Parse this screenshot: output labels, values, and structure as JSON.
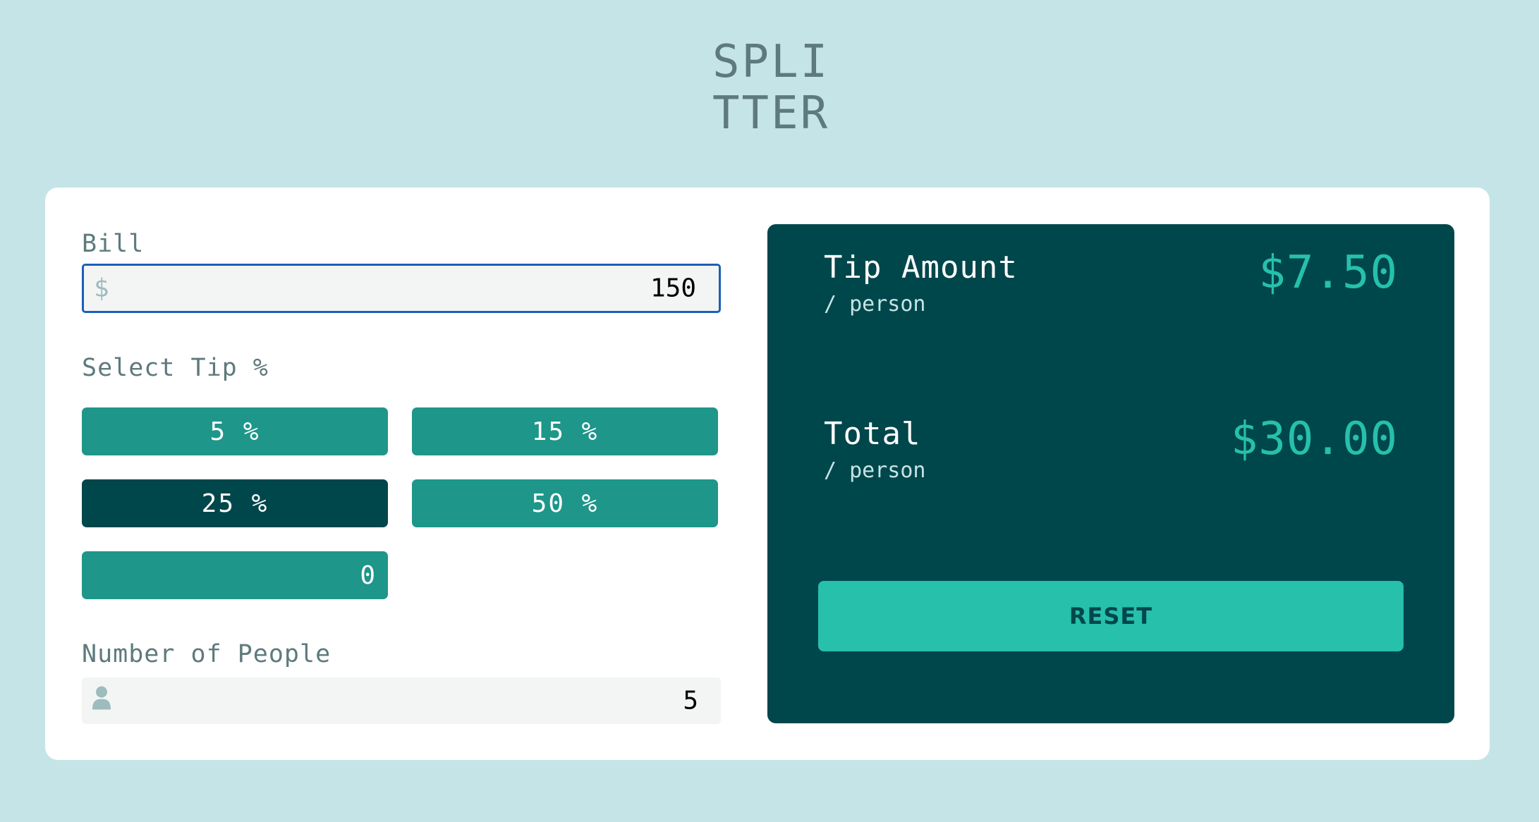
{
  "logo": {
    "line1": "SPLI",
    "line2": "TTER"
  },
  "bill": {
    "label": "Bill",
    "prefix": "$",
    "value": "150"
  },
  "tip": {
    "label": "Select Tip %",
    "options": [
      "5 %",
      "15 %",
      "25 %",
      "50 %"
    ],
    "selected": "25 %",
    "custom_value": "0"
  },
  "people": {
    "label": "Number of People",
    "value": "5"
  },
  "results": {
    "tip_label": "Tip Amount",
    "tip_sub": "/ person",
    "tip_value": "$7.50",
    "total_label": "Total",
    "total_sub": "/ person",
    "total_value": "$30.00",
    "reset_label": "RESET"
  },
  "colors": {
    "background": "#c5e4e7",
    "panel": "#00474b",
    "accent": "#26c0ab",
    "button": "#1e968a"
  },
  "icons": {
    "bill_prefix": "dollar-icon",
    "people_prefix": "person-icon"
  }
}
